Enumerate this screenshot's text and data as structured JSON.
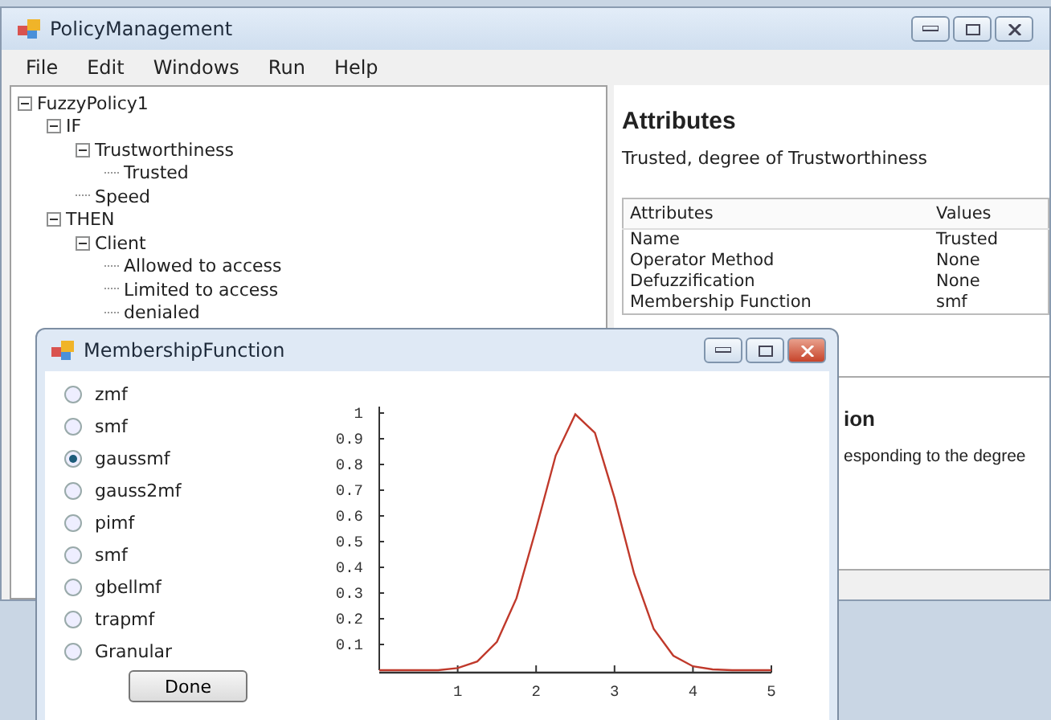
{
  "main_window": {
    "title": "PolicyManagement"
  },
  "menu": [
    "File",
    "Edit",
    "Windows",
    "Run",
    "Help"
  ],
  "tree": [
    {
      "label": "FuzzyPolicy1",
      "expanded": true,
      "children": [
        {
          "label": "IF",
          "expanded": true,
          "children": [
            {
              "label": "Trustworthiness",
              "expanded": true,
              "children": [
                {
                  "label": "Trusted"
                }
              ]
            },
            {
              "label": "Speed"
            }
          ]
        },
        {
          "label": "THEN",
          "expanded": true,
          "children": [
            {
              "label": "Client",
              "expanded": true,
              "children": [
                {
                  "label": "Allowed to access"
                },
                {
                  "label": "Limited to access"
                },
                {
                  "label": "denialed"
                }
              ]
            }
          ]
        }
      ]
    }
  ],
  "attributes": {
    "heading": "Attributes",
    "description": "Trusted, degree of Trustworthiness",
    "columns": [
      "Attributes",
      "Values"
    ],
    "rows": [
      [
        "Name",
        "Trusted"
      ],
      [
        "Operator Method",
        "None"
      ],
      [
        "Defuzzification",
        "None"
      ],
      [
        "Membership Function",
        "smf"
      ]
    ]
  },
  "detail": {
    "heading": "ion",
    "description": "esponding to the degree"
  },
  "dialog": {
    "title": "MembershipFunction",
    "options": [
      {
        "label": "zmf",
        "selected": false
      },
      {
        "label": "smf",
        "selected": false
      },
      {
        "label": "gaussmf",
        "selected": true
      },
      {
        "label": "gauss2mf",
        "selected": false
      },
      {
        "label": "pimf",
        "selected": false
      },
      {
        "label": "smf",
        "selected": false
      },
      {
        "label": "gbellmf",
        "selected": false
      },
      {
        "label": "trapmf",
        "selected": false
      },
      {
        "label": "Granular",
        "selected": false
      }
    ],
    "button": "Done",
    "chart_data": {
      "type": "line",
      "x": [
        0,
        0.25,
        0.5,
        0.75,
        1,
        1.25,
        1.5,
        1.75,
        2,
        2.25,
        2.5,
        2.75,
        3,
        3.25,
        3.5,
        3.75,
        4,
        4.25,
        4.5,
        4.75,
        5
      ],
      "series": [
        {
          "color": "#c0392b",
          "values": [
            0,
            0,
            0,
            0,
            0.008,
            0.034,
            0.11,
            0.28,
            0.55,
            0.835,
            0.995,
            0.923,
            0.67,
            0.375,
            0.16,
            0.056,
            0.015,
            0.003,
            0,
            0,
            0
          ]
        }
      ],
      "xlim": [
        0,
        5
      ],
      "ylim": [
        0,
        1.03
      ],
      "xticks": [
        1,
        2,
        3,
        4,
        5
      ],
      "yticks": [
        {
          "value": 0.1,
          "label": "0.1"
        },
        {
          "value": 0.2,
          "label": "0.2"
        },
        {
          "value": 0.3,
          "label": "0.3"
        },
        {
          "value": 0.4,
          "label": "0.4"
        },
        {
          "value": 0.5,
          "label": "0.5"
        },
        {
          "value": 0.6,
          "label": "0.6"
        },
        {
          "value": 0.7,
          "label": "0.7"
        },
        {
          "value": 0.8,
          "label": "0.8"
        },
        {
          "value": 0.9,
          "label": "0.9"
        },
        {
          "value": 1,
          "label": "1"
        }
      ]
    }
  }
}
